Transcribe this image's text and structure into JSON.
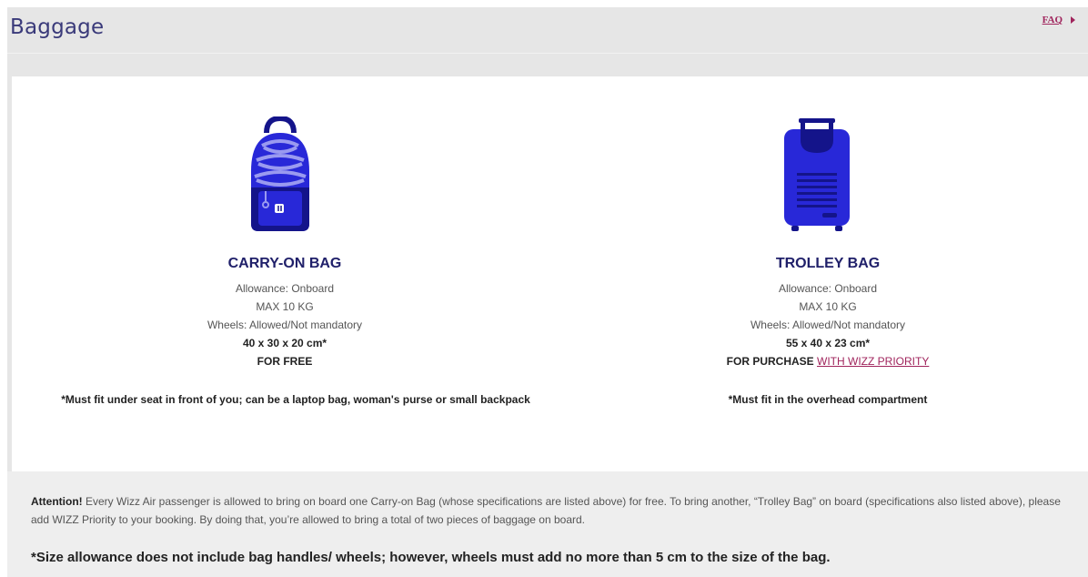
{
  "header": {
    "title": "Baggage",
    "faq_label": "FAQ"
  },
  "bags": {
    "carry_on": {
      "name": "CARRY-ON BAG",
      "allowance": "Allowance: Onboard",
      "max_weight": "MAX 10 KG",
      "wheels": "Wheels: Allowed/Not mandatory",
      "dimensions": "40 x 30 x 20 cm*",
      "price": "FOR FREE",
      "note": "*Must fit under seat in front of you; can be a laptop bag, woman's purse or small backpack",
      "icon": "backpack-icon"
    },
    "trolley": {
      "name": "TROLLEY BAG",
      "allowance": "Allowance: Onboard",
      "max_weight": "MAX 10 KG",
      "wheels": "Wheels: Allowed/Not mandatory",
      "dimensions": "55 x 40 x 23 cm*",
      "price_prefix": "FOR PURCHASE",
      "price_link": "WITH WIZZ PRIORITY",
      "note": "*Must fit in the overhead compartment",
      "icon": "trolley-bag-icon"
    }
  },
  "footer": {
    "attention_label": "Attention!",
    "attention_text": " Every Wizz Air passenger is allowed to bring on board one Carry-on Bag (whose specifications are listed above) for free. To bring another, “Trolley Bag” on board (specifications also listed above), please add WIZZ Priority to your booking. By doing that, you’re allowed to bring a total of two pieces of baggage on board.",
    "size_note": "*Size allowance does not include bag handles/ wheels; however, wheels must add no more than 5 cm to the size of the bag."
  },
  "colors": {
    "icon_blue": "#2828d8",
    "icon_dark": "#14148a",
    "title_color": "#3a3a7a",
    "link_color": "#a0245c",
    "bag_name_color": "#20206a"
  }
}
